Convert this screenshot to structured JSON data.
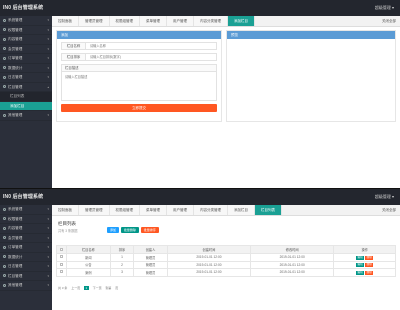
{
  "colors": {
    "topbar": "#23262e",
    "sidebar": "#2b2f3a",
    "accent": "#1aa094",
    "panel_head": "#5b9bd5",
    "danger": "#ff5722",
    "info": "#1e9fff"
  },
  "top": {
    "brand": "IN0 后台管理系统",
    "user": "超级管理"
  },
  "top_user_caret": "▾",
  "sidebar": {
    "items": [
      {
        "label": "系统管理",
        "icon": "gear-icon"
      },
      {
        "label": "权限管理",
        "icon": "key-icon"
      },
      {
        "label": "内容管理",
        "icon": "file-icon"
      },
      {
        "label": "会员管理",
        "icon": "user-icon"
      },
      {
        "label": "订单管理",
        "icon": "cart-icon"
      },
      {
        "label": "数据统计",
        "icon": "chart-icon"
      },
      {
        "label": "日志管理",
        "icon": "log-icon"
      },
      {
        "label": "栏目管理",
        "icon": "list-icon"
      }
    ],
    "sub_items": [
      {
        "label": "栏目列表"
      },
      {
        "label": "添加栏目"
      }
    ],
    "after": [
      {
        "label": "其他管理",
        "icon": "more-icon"
      }
    ]
  },
  "tabs": [
    "控制面板",
    "管理员管理",
    "权限组管理",
    "菜单管理",
    "用户管理",
    "内容分类管理",
    "添加栏目"
  ],
  "close_all": "关闭全部",
  "panel_left": {
    "head": "添加",
    "fields": [
      {
        "label": "栏目名称",
        "placeholder": "请输入名称"
      },
      {
        "label": "栏目排序",
        "placeholder": "请输入栏目排序(数字)"
      }
    ],
    "textarea_label": "栏目描述",
    "textarea_placeholder": "请输入栏目描述",
    "submit": "立即提交"
  },
  "panel_right": {
    "head": "预览"
  },
  "second": {
    "brand": "IN0 后台管理系统",
    "user": "超级管理",
    "tabs": [
      "控制面板",
      "管理员管理",
      "权限组管理",
      "菜单管理",
      "用户管理",
      "内容分类管理",
      "添加栏目",
      "栏目列表"
    ],
    "close_all": "关闭全部",
    "list_title": "栏目列表",
    "list_sub": "共有 3 条数据",
    "buttons": [
      "添加",
      "批量删除",
      "批量排序"
    ],
    "columns": [
      "栏目名称",
      "排序",
      "创建人",
      "创建时间",
      "修改时间",
      "操作"
    ],
    "rows": [
      [
        "新闻",
        "1",
        "管理员",
        "2019-01-01 12:00",
        "2019-01-01 12:00"
      ],
      [
        "公告",
        "2",
        "管理员",
        "2019-01-01 12:00",
        "2019-01-01 12:00"
      ],
      [
        "案例",
        "3",
        "管理员",
        "2019-01-01 12:00",
        "2019-01-01 12:00"
      ]
    ],
    "row_edit": "编辑",
    "row_del": "删除",
    "pager": {
      "total": "共 3 条",
      "prev": "上一页",
      "page": "1",
      "next": "下一页",
      "goto": "到第",
      "unit": "页"
    }
  }
}
